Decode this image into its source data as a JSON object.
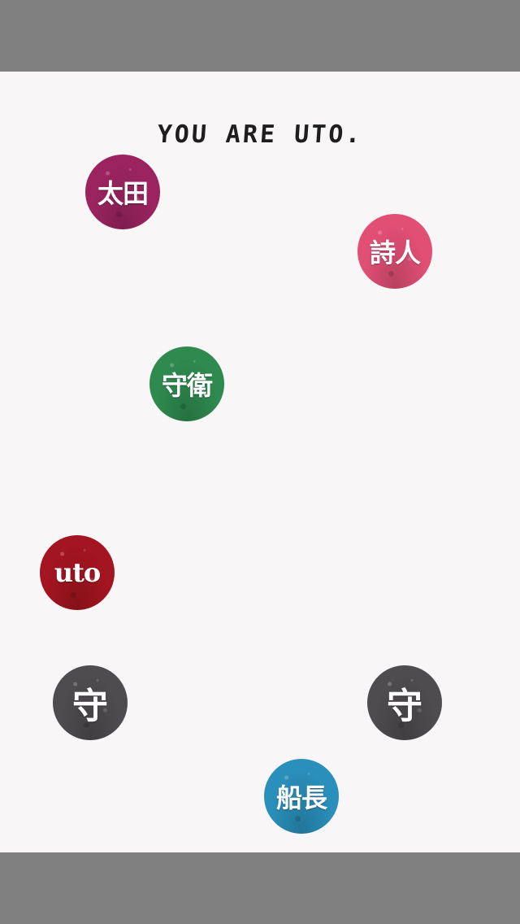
{
  "title": "YOU ARE UTO.",
  "tokens": [
    {
      "label": "太田",
      "color": "#9b2460",
      "icon": "character-token"
    },
    {
      "label": "詩人",
      "color": "#e14f75",
      "icon": "character-token"
    },
    {
      "label": "守衛",
      "color": "#2f8a4f",
      "icon": "character-token"
    },
    {
      "label": "uto",
      "color": "#a31520",
      "icon": "character-token"
    },
    {
      "label": "守",
      "color": "#4f4c50",
      "icon": "character-token"
    },
    {
      "label": "守",
      "color": "#4f4c50",
      "icon": "character-token"
    },
    {
      "label": "船長",
      "color": "#2a8fba",
      "icon": "character-token"
    }
  ]
}
